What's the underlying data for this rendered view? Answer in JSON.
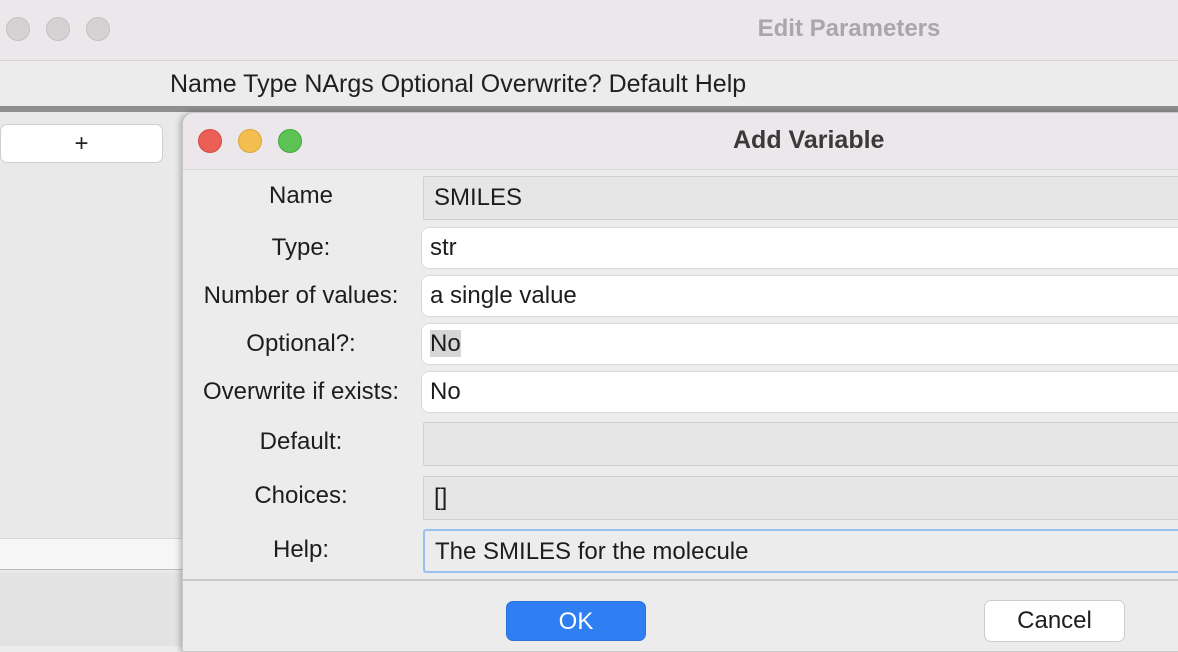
{
  "back_window": {
    "title": "Edit Parameters",
    "columns_header": "Name Type NArgs Optional Overwrite? Default Help",
    "add_button_label": "+"
  },
  "dialog": {
    "title": "Add Variable",
    "fields": {
      "name": {
        "label": "Name",
        "value": "SMILES"
      },
      "type": {
        "label": "Type:",
        "value": "str"
      },
      "nargs": {
        "label": "Number of values:",
        "value": "a single value"
      },
      "optional": {
        "label": "Optional?:",
        "value": "No"
      },
      "overwrite": {
        "label": "Overwrite if exists:",
        "value": "No"
      },
      "default": {
        "label": "Default:",
        "value": ""
      },
      "choices": {
        "label": "Choices:",
        "value": "[]"
      },
      "help": {
        "label": "Help:",
        "value": "The SMILES for the molecule"
      }
    },
    "ok_label": "OK",
    "cancel_label": "Cancel"
  },
  "colors": {
    "accent": "#2f7ff3",
    "close": "#ec5f56",
    "minimize": "#f3be4f",
    "zoom": "#5cc354"
  }
}
